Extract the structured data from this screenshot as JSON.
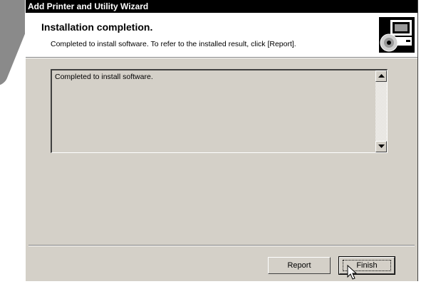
{
  "window": {
    "title": "Add Printer and Utility Wizard"
  },
  "header": {
    "title": "Installation completion.",
    "subtitle": "Completed to install software. To refer to the installed result, click [Report].",
    "icon": "computer-cd-icon"
  },
  "log": {
    "text": "Completed to install software."
  },
  "buttons": {
    "report_label": "Report",
    "finish_label": "Finish"
  },
  "colors": {
    "titlebar": "#000000",
    "face": "#d4d0c8",
    "header_bg": "#ffffff"
  }
}
